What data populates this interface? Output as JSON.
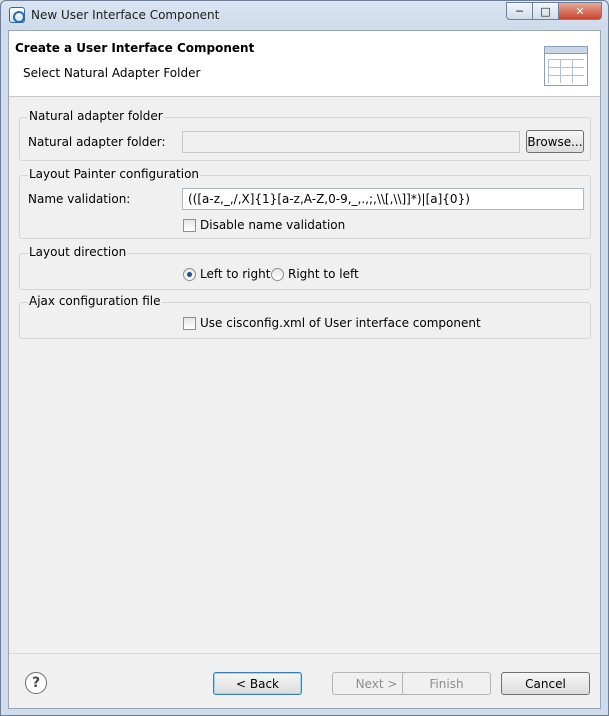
{
  "window": {
    "title": "New User Interface Component"
  },
  "banner": {
    "title": "Create a User Interface Component",
    "subtitle": "Select Natural Adapter Folder"
  },
  "adapter_group": {
    "title": "Natural adapter folder",
    "field_label": "Natural adapter folder:",
    "field_value": "",
    "browse_label": "Browse..."
  },
  "painter_group": {
    "title": "Layout Painter configuration",
    "name_validation_label": "Name validation:",
    "name_validation_value": "(([a-z,_,/,X]{1}[a-z,A-Z,0-9,_,.,;,\\\\[,\\\\]]*)|[a]{0})",
    "disable_label": "Disable name validation"
  },
  "direction_group": {
    "title": "Layout direction",
    "ltr_label": "Left to right",
    "rtl_label": "Right to left",
    "selected": "ltr"
  },
  "ajax_group": {
    "title": "Ajax configuration file",
    "use_config_label": "Use cisconfig.xml of User interface component"
  },
  "footer": {
    "back_label": "< Back",
    "next_label": "Next >",
    "finish_label": "Finish",
    "cancel_label": "Cancel"
  },
  "icons": {
    "help": "help-icon",
    "wizard": "wizard-banner-icon",
    "app": "app-icon"
  }
}
